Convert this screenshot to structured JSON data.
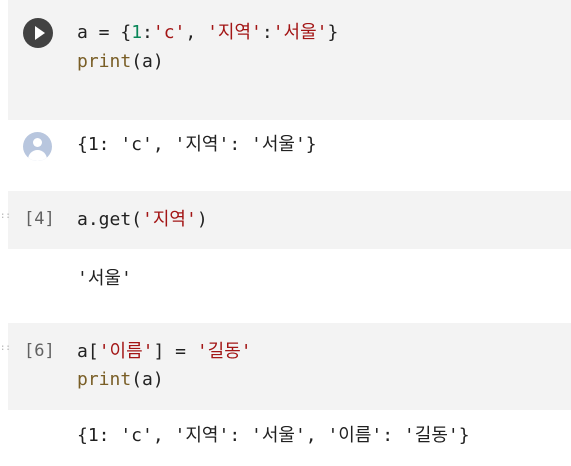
{
  "cells": [
    {
      "type": "code",
      "exec_label": "",
      "lines": [
        [
          {
            "t": "a = {",
            "c": "plain"
          },
          {
            "t": "1",
            "c": "num"
          },
          {
            "t": ":",
            "c": "plain"
          },
          {
            "t": "'c'",
            "c": "str"
          },
          {
            "t": ", ",
            "c": "plain"
          },
          {
            "t": "'지역'",
            "c": "str"
          },
          {
            "t": ":",
            "c": "plain"
          },
          {
            "t": "'서울'",
            "c": "str"
          },
          {
            "t": "}",
            "c": "plain"
          }
        ],
        [
          {
            "t": "print",
            "c": "fn"
          },
          {
            "t": "(a)",
            "c": "plain"
          }
        ]
      ],
      "output": "{1: 'c', '지역': '서울'}"
    },
    {
      "type": "code",
      "exec_label": "[4]",
      "lines": [
        [
          {
            "t": "a.get(",
            "c": "plain"
          },
          {
            "t": "'지역'",
            "c": "str"
          },
          {
            "t": ")",
            "c": "plain"
          }
        ]
      ],
      "output": "'서울'"
    },
    {
      "type": "code",
      "exec_label": "[6]",
      "lines": [
        [
          {
            "t": "a[",
            "c": "plain"
          },
          {
            "t": "'이름'",
            "c": "str"
          },
          {
            "t": "] = ",
            "c": "plain"
          },
          {
            "t": "'길동'",
            "c": "str"
          }
        ],
        [
          {
            "t": "print",
            "c": "fn"
          },
          {
            "t": "(a)",
            "c": "plain"
          }
        ]
      ],
      "output": "{1: 'c', '지역': '서울', '이름': '길동'}"
    }
  ],
  "icons": {
    "run": "play-circle-icon",
    "output_avatar": "user-avatar-icon"
  },
  "colors": {
    "cell_background": "#f3f3f3",
    "string": "#a31515",
    "number": "#098658",
    "function": "#795e26",
    "run_button": "#424242"
  }
}
